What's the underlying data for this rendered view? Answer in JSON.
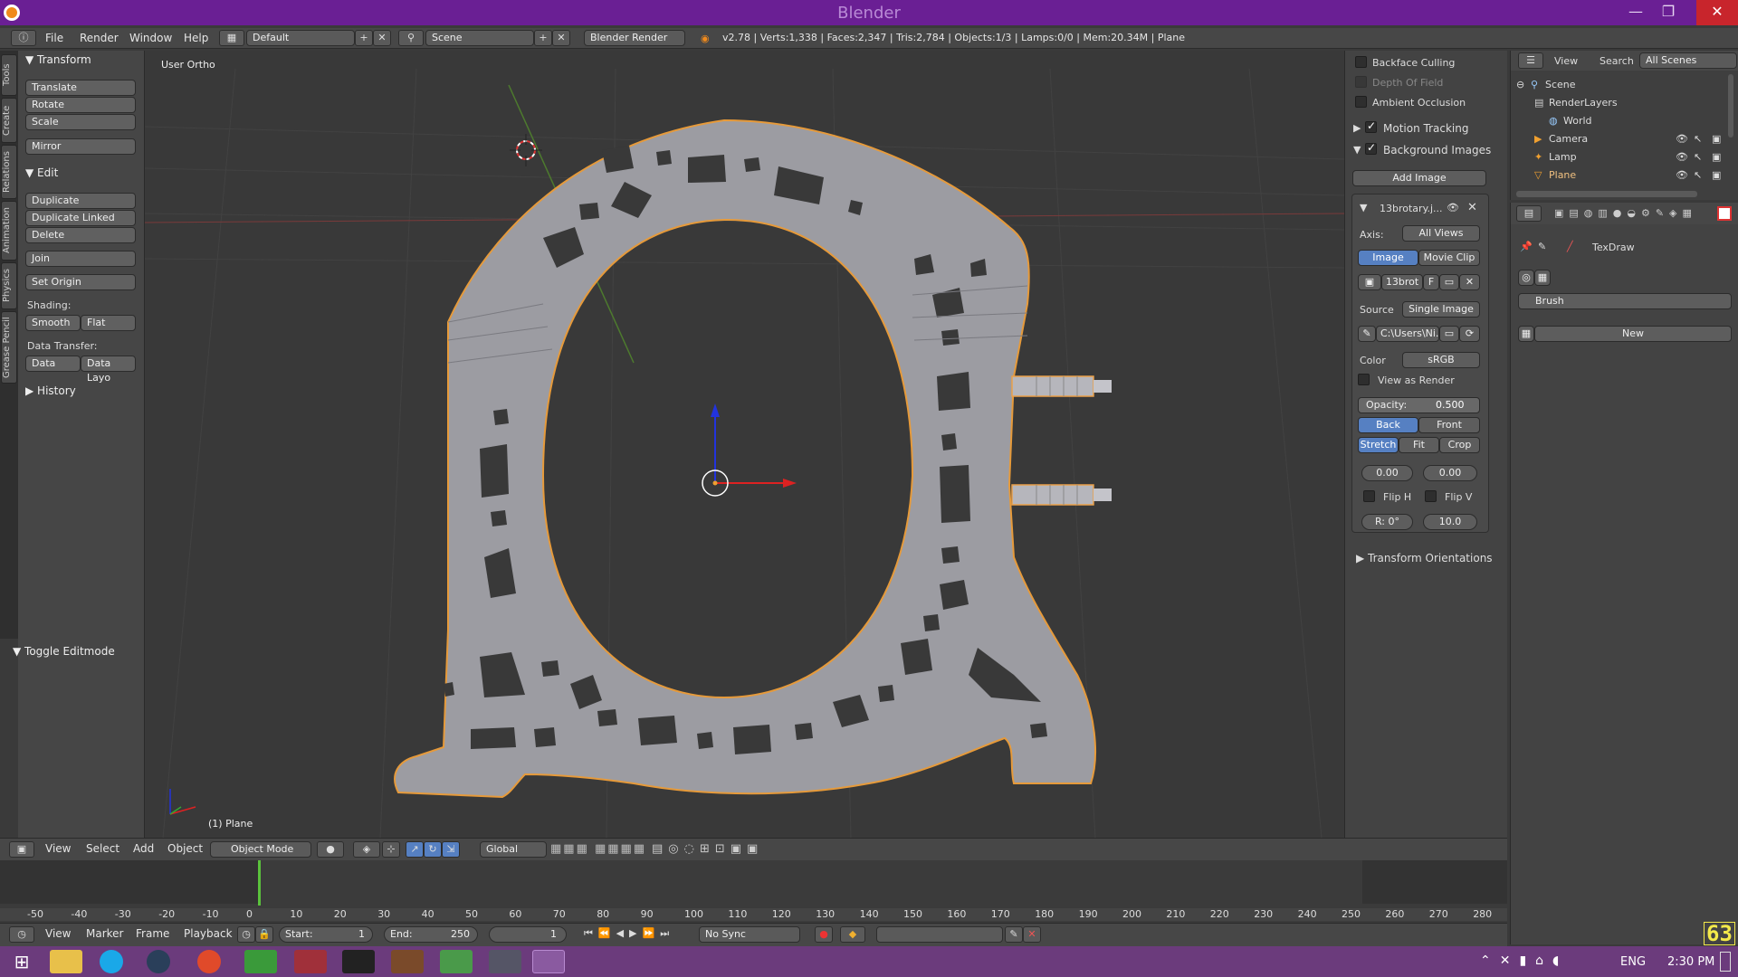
{
  "window": {
    "title": "Blender",
    "minimize": "—",
    "maximize": "❐",
    "close": "✕"
  },
  "menubar": {
    "items": [
      "File",
      "Render",
      "Window",
      "Help"
    ],
    "layout": "Default",
    "scene": "Scene",
    "engine": "Blender Render",
    "stats": "v2.78 | Verts:1,338 | Faces:2,347 | Tris:2,784 | Objects:1/3 | Lamps:0/0 | Mem:20.34M | Plane"
  },
  "tabs": [
    "Tools",
    "Create",
    "Relations",
    "Animation",
    "Physics",
    "Grease Pencil"
  ],
  "toolshelf": {
    "transform_header": "Transform",
    "translate": "Translate",
    "rotate": "Rotate",
    "scale": "Scale",
    "mirror": "Mirror",
    "edit_header": "Edit",
    "duplicate": "Duplicate",
    "duplicate_linked": "Duplicate Linked",
    "delete": "Delete",
    "join": "Join",
    "set_origin": "Set Origin",
    "shading_label": "Shading:",
    "smooth": "Smooth",
    "flat": "Flat",
    "data_transfer_label": "Data Transfer:",
    "data": "Data",
    "data_layout": "Data Layo",
    "history_header": "History",
    "toggle_editmode": "Toggle Editmode"
  },
  "viewport": {
    "view_label": "User Ortho",
    "object_label": "(1) Plane"
  },
  "props": {
    "backface": "Backface Culling",
    "dof": "Depth Of Field",
    "ao": "Ambient Occlusion",
    "motion": "Motion Tracking",
    "bg_images": "Background Images",
    "add_image": "Add Image",
    "image_name": "13brotary.j...",
    "axis_label": "Axis:",
    "axis_value": "All Views",
    "tab_image": "Image",
    "tab_movie": "Movie Clip",
    "img_block": "13brot",
    "img_f": "F",
    "source_label": "Source",
    "source_value": "Single Image",
    "path": "C:\\Users\\Ni...",
    "color_label": "Color",
    "color_value": "sRGB",
    "view_as_render": "View as Render",
    "opacity": "Opacity:",
    "opacity_value": "0.500",
    "back": "Back",
    "front": "Front",
    "stretch": "Stretch",
    "fit": "Fit",
    "crop": "Crop",
    "x_val": "0.00",
    "y_val": "0.00",
    "fliph": "Flip H",
    "flipv": "Flip V",
    "rot": "R: 0°",
    "size": "10.0",
    "transform_orient": "Transform Orientations"
  },
  "outliner": {
    "view": "View",
    "search": "Search",
    "filter": "All Scenes",
    "items": [
      "Scene",
      "RenderLayers",
      "World",
      "Camera",
      "Lamp",
      "Plane"
    ]
  },
  "properties": {
    "brush_name": "TexDraw",
    "brush_field": "Brush",
    "new_btn": "New"
  },
  "viewheader": {
    "view": "View",
    "select": "Select",
    "add": "Add",
    "object": "Object",
    "mode": "Object Mode",
    "orientation": "Global"
  },
  "timeline": {
    "ticks": [
      "-50",
      "-40",
      "-30",
      "-20",
      "-10",
      "0",
      "10",
      "20",
      "30",
      "40",
      "50",
      "60",
      "70",
      "80",
      "90",
      "100",
      "110",
      "120",
      "130",
      "140",
      "150",
      "160",
      "170",
      "180",
      "190",
      "200",
      "210",
      "220",
      "230",
      "240",
      "250",
      "260",
      "270",
      "280"
    ],
    "view": "View",
    "marker": "Marker",
    "frame": "Frame",
    "playback": "Playback",
    "start": "Start:",
    "start_val": "1",
    "end": "End:",
    "end_val": "250",
    "current": "1",
    "sync": "No Sync",
    "fps": "63"
  },
  "taskbar": {
    "lang": "ENG",
    "time": "2:30 PM"
  }
}
